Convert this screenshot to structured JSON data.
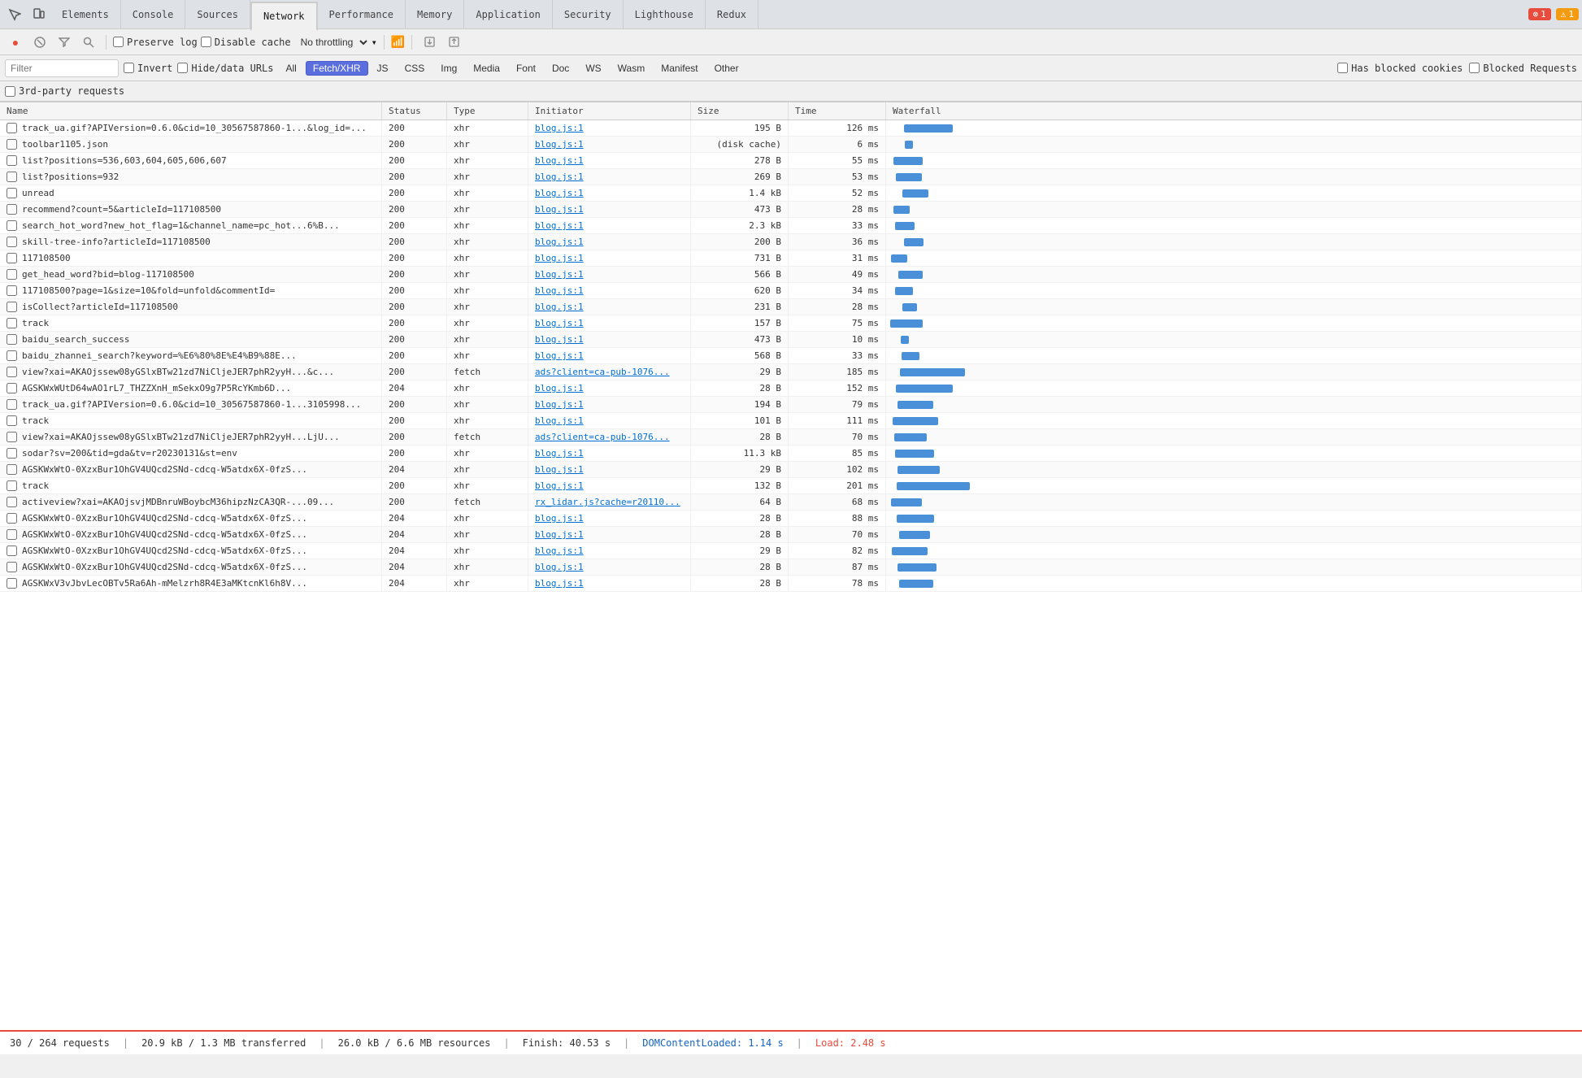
{
  "tabs": {
    "items": [
      {
        "label": "Elements",
        "active": false
      },
      {
        "label": "Console",
        "active": false
      },
      {
        "label": "Sources",
        "active": false
      },
      {
        "label": "Network",
        "active": true
      },
      {
        "label": "Performance",
        "active": false
      },
      {
        "label": "Memory",
        "active": false
      },
      {
        "label": "Application",
        "active": false
      },
      {
        "label": "Security",
        "active": false
      },
      {
        "label": "Lighthouse",
        "active": false
      },
      {
        "label": "Redux",
        "active": false
      }
    ],
    "error_count": "1",
    "warn_count": "1"
  },
  "toolbar": {
    "preserve_log_label": "Preserve log",
    "disable_cache_label": "Disable cache",
    "throttling_label": "No throttling",
    "invert_label": "Invert",
    "hide_data_urls_label": "Hide/data URLs",
    "filter_placeholder": "Filter",
    "has_blocked_label": "Has blocked cookies",
    "blocked_requests_label": "Blocked Requests",
    "third_party_label": "3rd-party requests"
  },
  "filter_buttons": [
    "All",
    "Fetch/XHR",
    "JS",
    "CSS",
    "Img",
    "Media",
    "Font",
    "Doc",
    "WS",
    "Wasm",
    "Manifest",
    "Other"
  ],
  "active_filter": "Fetch/XHR",
  "columns": [
    "Name",
    "Status",
    "Type",
    "Initiator",
    "Size",
    "Time",
    "Waterfall"
  ],
  "rows": [
    {
      "name": "track_ua.gif?APIVersion=0.6.0&cid=10_30567587860-1...&log_id=...",
      "status": "200",
      "type": "xhr",
      "initiator": "blog.js:1",
      "size": "195 B",
      "time": "126 ms",
      "bar": 30
    },
    {
      "name": "toolbar1105.json",
      "status": "200",
      "type": "xhr",
      "initiator": "blog.js:1",
      "size": "(disk cache)",
      "time": "6 ms",
      "bar": 5
    },
    {
      "name": "list?positions=536,603,604,605,606,607",
      "status": "200",
      "type": "xhr",
      "initiator": "blog.js:1",
      "size": "278 B",
      "time": "55 ms",
      "bar": 18
    },
    {
      "name": "list?positions=932",
      "status": "200",
      "type": "xhr",
      "initiator": "blog.js:1",
      "size": "269 B",
      "time": "53 ms",
      "bar": 16
    },
    {
      "name": "unread",
      "status": "200",
      "type": "xhr",
      "initiator": "blog.js:1",
      "size": "1.4 kB",
      "time": "52 ms",
      "bar": 16
    },
    {
      "name": "recommend?count=5&articleId=117108500",
      "status": "200",
      "type": "xhr",
      "initiator": "blog.js:1",
      "size": "473 B",
      "time": "28 ms",
      "bar": 10
    },
    {
      "name": "search_hot_word?new_hot_flag=1&channel_name=pc_hot...6%B...",
      "status": "200",
      "type": "xhr",
      "initiator": "blog.js:1",
      "size": "2.3 kB",
      "time": "33 ms",
      "bar": 12
    },
    {
      "name": "skill-tree-info?articleId=117108500",
      "status": "200",
      "type": "xhr",
      "initiator": "blog.js:1",
      "size": "200 B",
      "time": "36 ms",
      "bar": 12
    },
    {
      "name": "117108500",
      "status": "200",
      "type": "xhr",
      "initiator": "blog.js:1",
      "size": "731 B",
      "time": "31 ms",
      "bar": 10
    },
    {
      "name": "get_head_word?bid=blog-117108500",
      "status": "200",
      "type": "xhr",
      "initiator": "blog.js:1",
      "size": "566 B",
      "time": "49 ms",
      "bar": 15
    },
    {
      "name": "117108500?page=1&size=10&fold=unfold&commentId=",
      "status": "200",
      "type": "xhr",
      "initiator": "blog.js:1",
      "size": "620 B",
      "time": "34 ms",
      "bar": 11
    },
    {
      "name": "isCollect?articleId=117108500",
      "status": "200",
      "type": "xhr",
      "initiator": "blog.js:1",
      "size": "231 B",
      "time": "28 ms",
      "bar": 9
    },
    {
      "name": "track",
      "status": "200",
      "type": "xhr",
      "initiator": "blog.js:1",
      "size": "157 B",
      "time": "75 ms",
      "bar": 20
    },
    {
      "name": "baidu_search_success",
      "status": "200",
      "type": "xhr",
      "initiator": "blog.js:1",
      "size": "473 B",
      "time": "10 ms",
      "bar": 5
    },
    {
      "name": "baidu_zhannei_search?keyword=%E6%80%8E%E4%B9%88E...",
      "status": "200",
      "type": "xhr",
      "initiator": "blog.js:1",
      "size": "568 B",
      "time": "33 ms",
      "bar": 11
    },
    {
      "name": "view?xai=AKAOjssew08yGSlxBTw21zd7NiCljeJER7phR2yyH...&c...",
      "status": "200",
      "type": "fetch",
      "initiator": "ads?client=ca-pub-1076...",
      "size": "29 B",
      "time": "185 ms",
      "bar": 40
    },
    {
      "name": "AGSKWxWUtD64wAO1rL7_THZZXnH_mSekxO9g7P5RcYKmb6D...",
      "status": "204",
      "type": "xhr",
      "initiator": "blog.js:1",
      "size": "28 B",
      "time": "152 ms",
      "bar": 35
    },
    {
      "name": "track_ua.gif?APIVersion=0.6.0&cid=10_30567587860-1...3105998...",
      "status": "200",
      "type": "xhr",
      "initiator": "blog.js:1",
      "size": "194 B",
      "time": "79 ms",
      "bar": 22
    },
    {
      "name": "track",
      "status": "200",
      "type": "xhr",
      "initiator": "blog.js:1",
      "size": "101 B",
      "time": "111 ms",
      "bar": 28
    },
    {
      "name": "view?xai=AKAOjssew08yGSlxBTw21zd7NiCljeJER7phR2yyH...LjU...",
      "status": "200",
      "type": "fetch",
      "initiator": "ads?client=ca-pub-1076...",
      "size": "28 B",
      "time": "70 ms",
      "bar": 20
    },
    {
      "name": "sodar?sv=200&tid=gda&tv=r20230131&st=env",
      "status": "200",
      "type": "xhr",
      "initiator": "blog.js:1",
      "size": "11.3 kB",
      "time": "85 ms",
      "bar": 24
    },
    {
      "name": "AGSKWxWtO-0XzxBur1OhGV4UQcd2SNd-cdcq-W5atdx6X-0fzS...",
      "status": "204",
      "type": "xhr",
      "initiator": "blog.js:1",
      "size": "29 B",
      "time": "102 ms",
      "bar": 26
    },
    {
      "name": "track",
      "status": "200",
      "type": "xhr",
      "initiator": "blog.js:1",
      "size": "132 B",
      "time": "201 ms",
      "bar": 45
    },
    {
      "name": "activeview?xai=AKAOjsvjMDBnruWBoybcM36hipzNzCA3QR-...09...",
      "status": "200",
      "type": "fetch",
      "initiator": "rx_lidar.js?cache=r20110...",
      "size": "64 B",
      "time": "68 ms",
      "bar": 19
    },
    {
      "name": "AGSKWxWtO-0XzxBur1OhGV4UQcd2SNd-cdcq-W5atdx6X-0fzS...",
      "status": "204",
      "type": "xhr",
      "initiator": "blog.js:1",
      "size": "28 B",
      "time": "88 ms",
      "bar": 23
    },
    {
      "name": "AGSKWxWtO-0XzxBur1OhGV4UQcd2SNd-cdcq-W5atdx6X-0fzS...",
      "status": "204",
      "type": "xhr",
      "initiator": "blog.js:1",
      "size": "28 B",
      "time": "70 ms",
      "bar": 19
    },
    {
      "name": "AGSKWxWtO-0XzxBur1OhGV4UQcd2SNd-cdcq-W5atdx6X-0fzS...",
      "status": "204",
      "type": "xhr",
      "initiator": "blog.js:1",
      "size": "29 B",
      "time": "82 ms",
      "bar": 22
    },
    {
      "name": "AGSKWxWtO-0XzxBur1OhGV4UQcd2SNd-cdcq-W5atdx6X-0fzS...",
      "status": "204",
      "type": "xhr",
      "initiator": "blog.js:1",
      "size": "28 B",
      "time": "87 ms",
      "bar": 24
    },
    {
      "name": "AGSKWxV3vJbvLecOBTv5Ra6Ah-mMelzrh8R4E3aMKtcnKl6h8V...",
      "status": "204",
      "type": "xhr",
      "initiator": "blog.js:1",
      "size": "28 B",
      "time": "78 ms",
      "bar": 21
    }
  ],
  "status_bar": {
    "requests": "30 / 264 requests",
    "transferred": "20.9 kB / 1.3 MB transferred",
    "resources": "26.0 kB / 6.6 MB resources",
    "finish": "Finish: 40.53 s",
    "dom_content": "DOMContentLoaded: 1.14 s",
    "load": "Load: 2.48 s"
  }
}
